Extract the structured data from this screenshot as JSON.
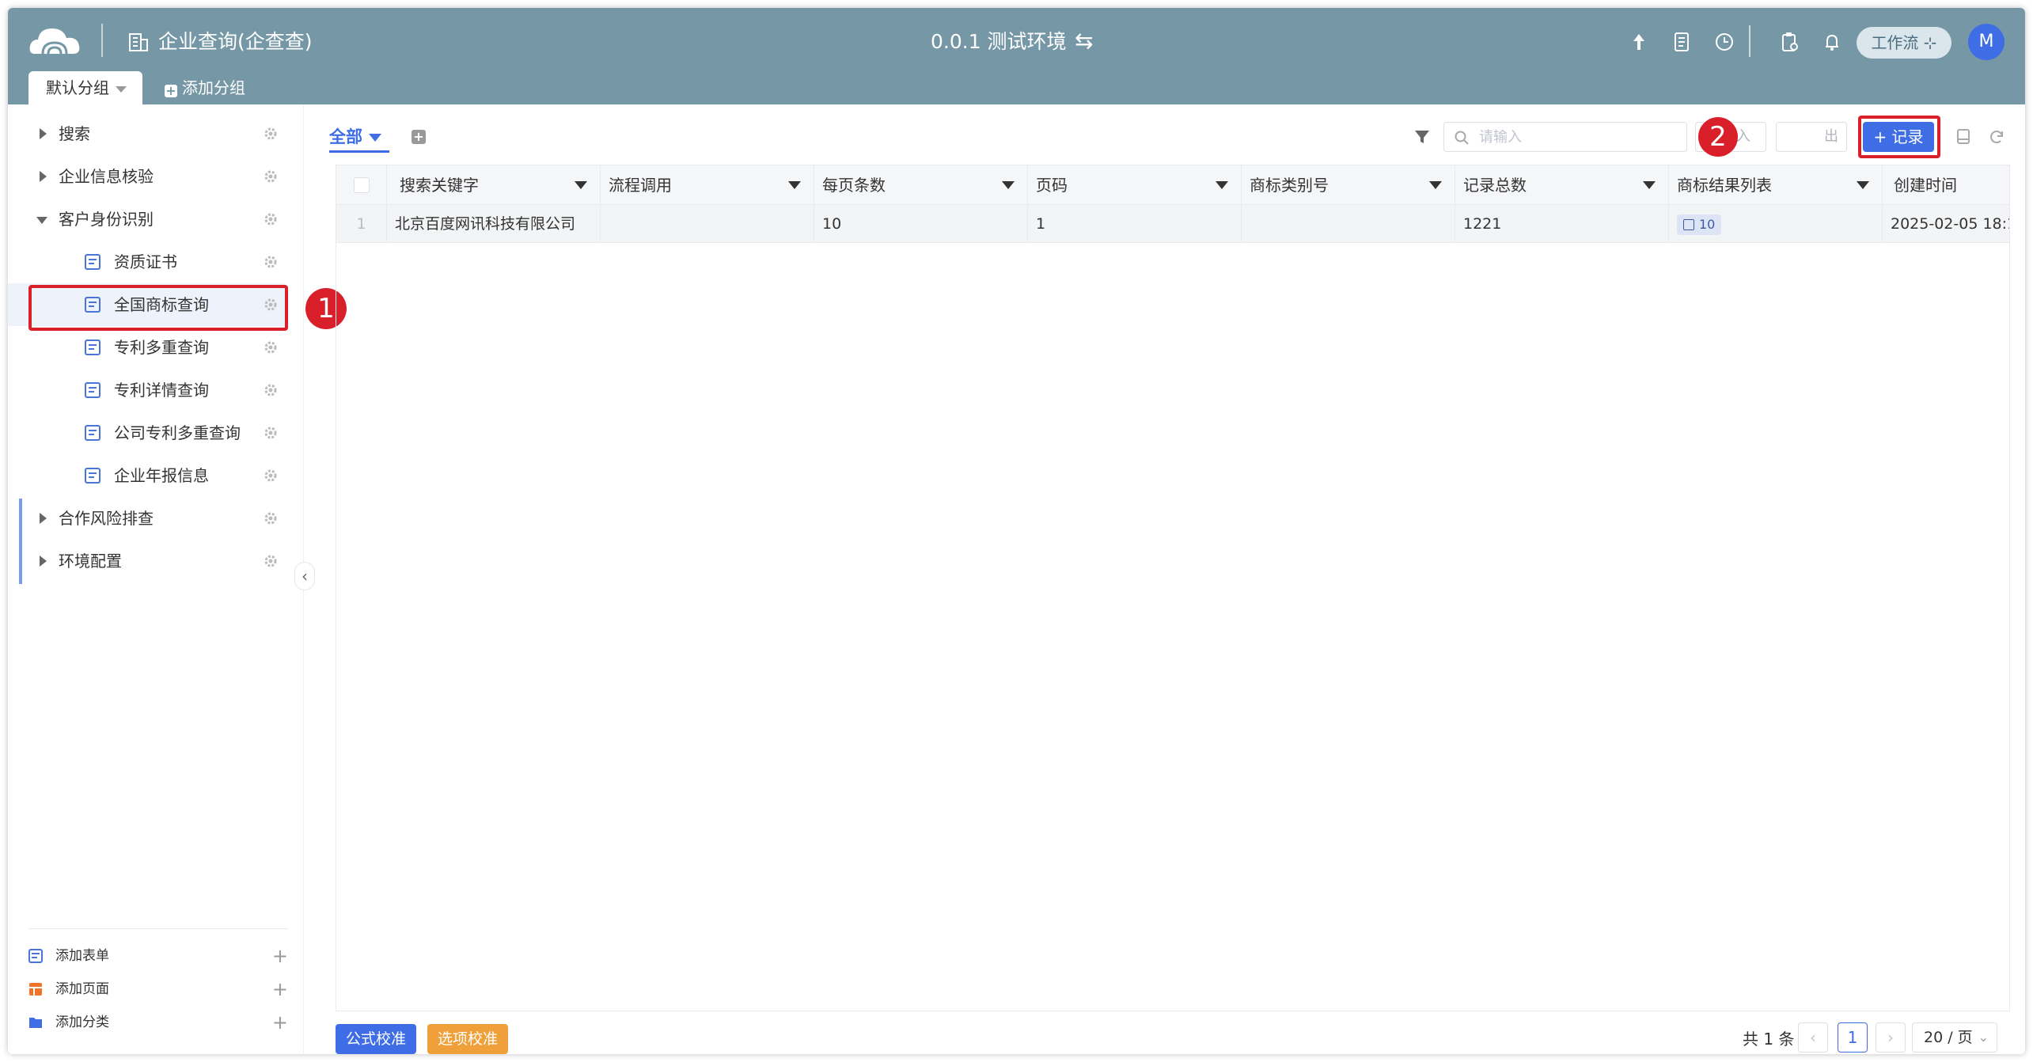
{
  "header": {
    "app_title": "企业查询(企查查)",
    "environment": "0.0.1 测试环境",
    "swap_glyph": "⇆",
    "workflow_label": "工作流 ⊹",
    "avatar_initial": "M",
    "group_tab": "默认分组",
    "add_group": "添加分组",
    "colors": {
      "header_bg": "#7698a6",
      "accent": "#3e6de6",
      "highlight": "#d9202a"
    }
  },
  "sidebar": {
    "items": [
      {
        "label": "搜索",
        "level": 0,
        "expanded": false
      },
      {
        "label": "企业信息核验",
        "level": 0,
        "expanded": false
      },
      {
        "label": "客户身份识别",
        "level": 0,
        "expanded": true
      },
      {
        "label": "资质证书",
        "level": 1
      },
      {
        "label": "全国商标查询",
        "level": 1,
        "selected": true
      },
      {
        "label": "专利多重查询",
        "level": 1
      },
      {
        "label": "专利详情查询",
        "level": 1
      },
      {
        "label": "公司专利多重查询",
        "level": 1
      },
      {
        "label": "企业年报信息",
        "level": 1
      },
      {
        "label": "合作风险排查",
        "level": 0,
        "expanded": false
      },
      {
        "label": "环境配置",
        "level": 0,
        "expanded": false
      }
    ],
    "bottom": [
      {
        "label": "添加表单",
        "icon": "form-icon"
      },
      {
        "label": "添加页面",
        "icon": "page-icon"
      },
      {
        "label": "添加分类",
        "icon": "folder-icon"
      }
    ],
    "collapse_glyph": "‹",
    "plus_glyph": "+"
  },
  "annotations": {
    "badge1": "1",
    "badge2": "2"
  },
  "toolbar": {
    "view_tab": "全部",
    "search_placeholder": "请输入",
    "import_label": "⤓ 导入",
    "export_label": "出",
    "add_record_label": "+ 记录"
  },
  "table": {
    "columns": [
      "搜索关键字",
      "流程调用",
      "每页条数",
      "页码",
      "商标类别号",
      "记录总数",
      "商标结果列表",
      "创建时间"
    ],
    "rows": [
      {
        "num": "1",
        "cells": [
          "北京百度网讯科技有限公司",
          "",
          "10",
          "1",
          "",
          "1221",
          "10",
          "2025-02-05 18:1"
        ]
      }
    ]
  },
  "footer": {
    "formula_btn": "公式校准",
    "option_btn": "选项校准",
    "total": "共 1 条",
    "prev": "‹",
    "current_page": "1",
    "next": "›",
    "page_size": "20 / 页",
    "page_size_chev": "⌄"
  }
}
